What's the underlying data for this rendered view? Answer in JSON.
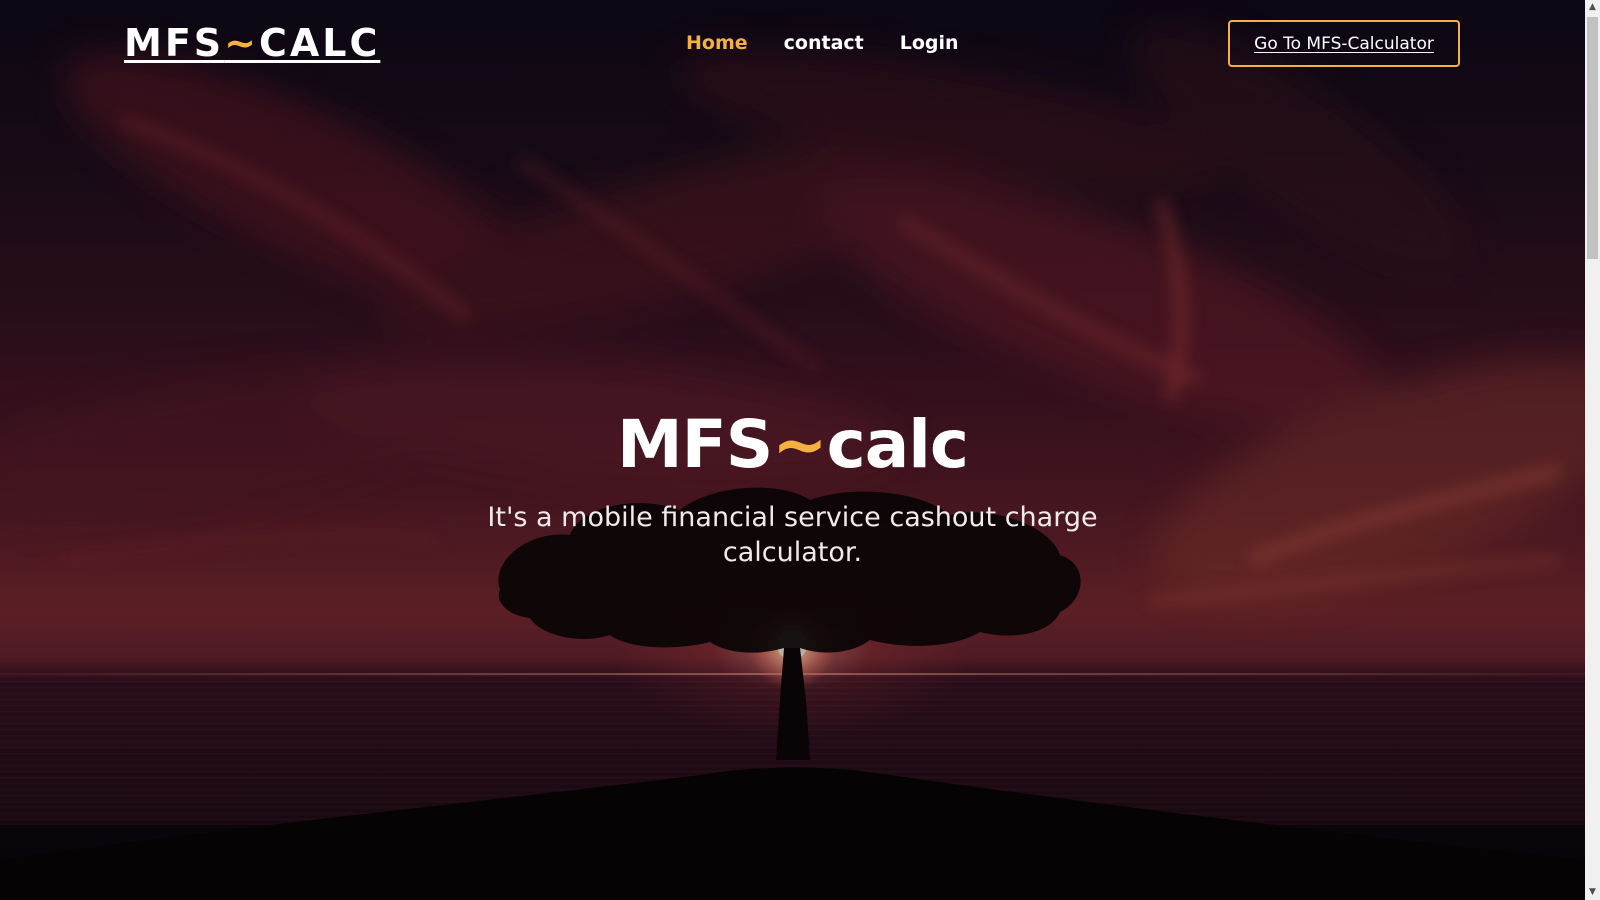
{
  "navbar": {
    "logo_main": "MFS",
    "logo_sep": "~",
    "logo_end": "CALC",
    "links": [
      "Home",
      "contact",
      "Login"
    ],
    "active_link": "Home",
    "cta_label": "Go To MFS-Calculator"
  },
  "hero": {
    "title_main": "MFS",
    "title_sep": "~",
    "title_end": "calc",
    "subtitle": "It's a mobile financial service cashout charge calculator."
  },
  "scrollbar": {
    "up_icon": "triangle-up-icon",
    "down_icon": "triangle-down-icon"
  },
  "colors": {
    "accent": "#f5b041",
    "text": "#ffffff"
  }
}
